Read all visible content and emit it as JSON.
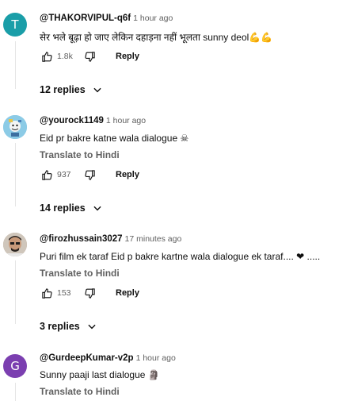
{
  "comments": [
    {
      "avatar_letter": "T",
      "avatar_color": "#1a9ea8",
      "author": "@THAKORVIPUL-q6f",
      "time": "1 hour ago",
      "text": "सेर भले बूढ़ा हो जाए लेकिन दहाड़ना नहीं भूलता sunny deol💪💪",
      "likes": "1.8k",
      "reply_label": "Reply",
      "replies_label": "12 replies"
    },
    {
      "avatar_letter": "",
      "avatar_color": "#7ec3e3",
      "author": "@yourock1149",
      "time": "1 hour ago",
      "text": "Eid pr bakre katne wala dialogue ☠",
      "translate_label": "Translate to Hindi",
      "likes": "937",
      "reply_label": "Reply",
      "replies_label": "14 replies"
    },
    {
      "avatar_letter": "",
      "avatar_color": "#b8a58f",
      "author": "@firozhussain3027",
      "time": "17 minutes ago",
      "text": "Puri film ek taraf Eid p bakre kartne wala dialogue ek taraf.... ❤ .....",
      "translate_label": "Translate to Hindi",
      "likes": "153",
      "reply_label": "Reply",
      "replies_label": "3 replies"
    },
    {
      "avatar_letter": "G",
      "avatar_color": "#7b3fb0",
      "author": "@GurdeepKumar-v2p",
      "time": "1 hour ago",
      "text": "Sunny paaji last dialogue 🗿",
      "translate_label": "Translate to Hindi"
    }
  ]
}
